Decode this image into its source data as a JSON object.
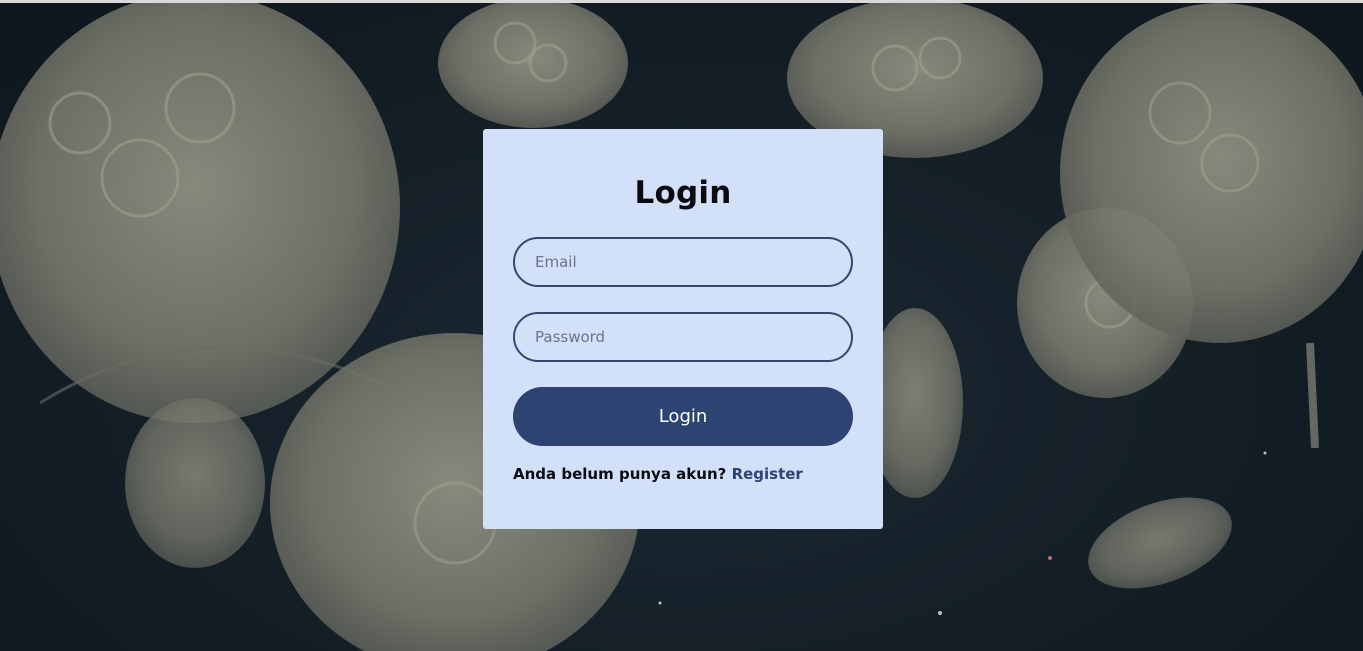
{
  "login_card": {
    "title": "Login",
    "email_placeholder": "Email",
    "password_placeholder": "Password",
    "login_button_label": "Login",
    "register_prompt": "Anda belum punya akun?",
    "register_link_label": "Register"
  },
  "colors": {
    "card_background": "#d3e0fa",
    "accent": "#2d4372",
    "input_border": "#374670",
    "page_background": "#152029"
  },
  "background_image": "jellyfish"
}
